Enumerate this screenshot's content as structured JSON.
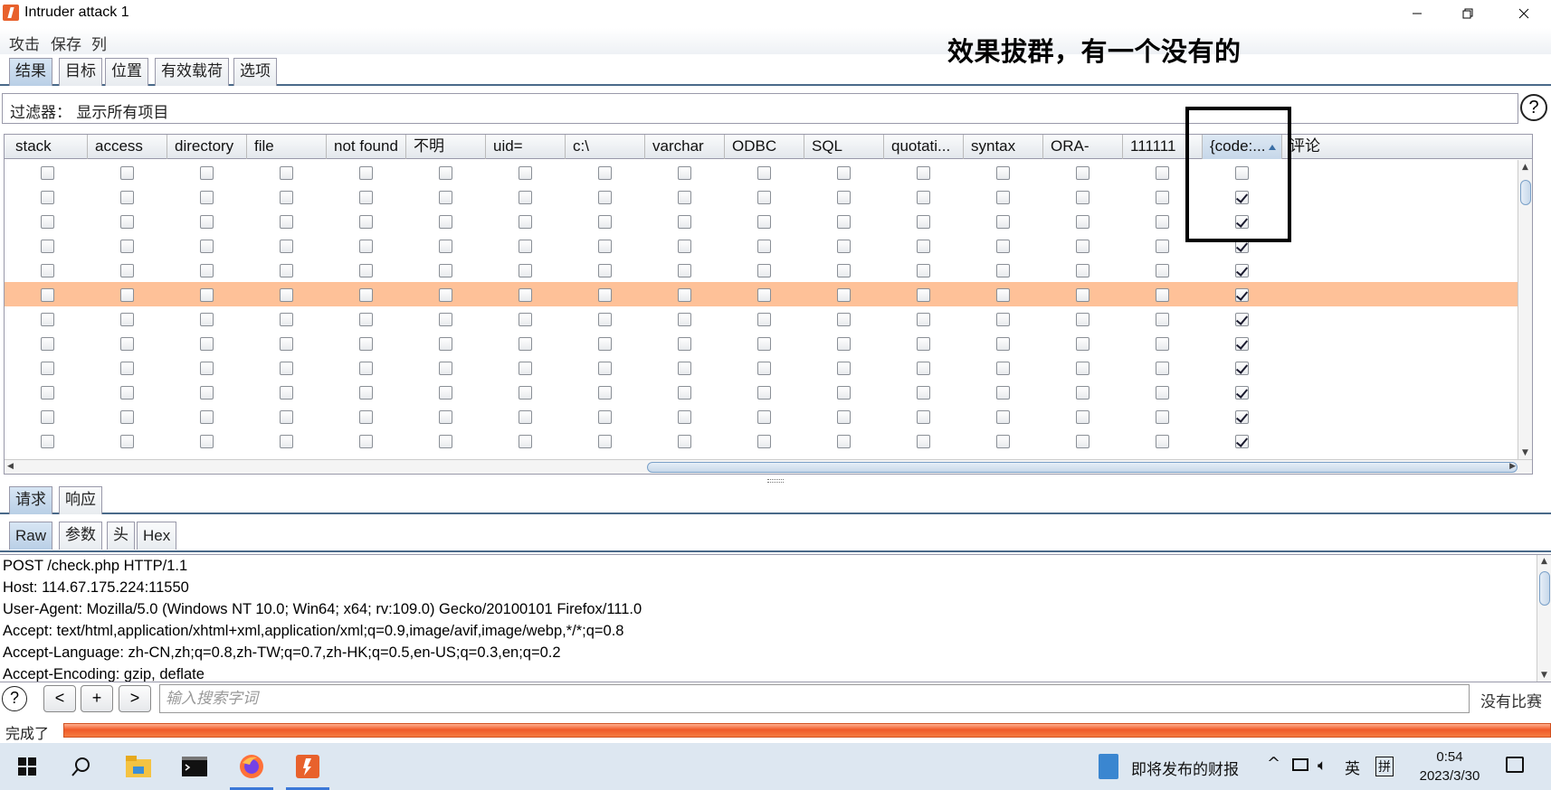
{
  "window": {
    "title": "Intruder attack 1"
  },
  "menu": [
    "攻击",
    "保存",
    "列"
  ],
  "annotation_text": "效果拔群，有一个没有的",
  "results_tabs": [
    "结果",
    "目标",
    "位置",
    "有效载荷",
    "选项"
  ],
  "filter": {
    "label": "过滤器：",
    "value": "显示所有项目"
  },
  "help_symbol": "?",
  "table": {
    "columns": [
      "stack",
      "access",
      "directory",
      "file",
      "not found",
      "不明",
      "uid=",
      "c:\\",
      "varchar",
      "ODBC",
      "SQL",
      "quotati...",
      "syntax",
      "ORA-",
      "111111",
      "{code:...",
      "评论"
    ],
    "sorted_column": "{code:...",
    "rows": [
      {
        "code_checked": false,
        "highlight": false
      },
      {
        "code_checked": true,
        "highlight": false
      },
      {
        "code_checked": true,
        "highlight": false
      },
      {
        "code_checked": true,
        "highlight": false
      },
      {
        "code_checked": true,
        "highlight": false
      },
      {
        "code_checked": true,
        "highlight": true
      },
      {
        "code_checked": true,
        "highlight": false
      },
      {
        "code_checked": true,
        "highlight": false
      },
      {
        "code_checked": true,
        "highlight": false
      },
      {
        "code_checked": true,
        "highlight": false
      },
      {
        "code_checked": true,
        "highlight": false
      },
      {
        "code_checked": true,
        "highlight": false
      },
      {
        "code_checked": true,
        "highlight": false
      }
    ],
    "highlight_color": "#fec198"
  },
  "req_tabs": [
    "请求",
    "响应"
  ],
  "view_tabs": [
    "Raw",
    "参数",
    "头",
    "Hex"
  ],
  "request_lines": [
    "POST /check.php HTTP/1.1",
    "Host: 114.67.175.224:11550",
    "User-Agent: Mozilla/5.0 (Windows NT 10.0; Win64; x64; rv:109.0) Gecko/20100101 Firefox/111.0",
    "Accept: text/html,application/xhtml+xml,application/xml;q=0.9,image/avif,image/webp,*/*;q=0.8",
    "Accept-Language: zh-CN,zh;q=0.8,zh-TW;q=0.7,zh-HK;q=0.5,en-US;q=0.3,en;q=0.2",
    "Accept-Encoding: gzip, deflate"
  ],
  "search": {
    "prev": "<",
    "add": "+",
    "next": ">",
    "placeholder": "输入搜索字词",
    "result": "没有比赛"
  },
  "status": {
    "label": "完成了",
    "progress": 1.0,
    "color": "#f05a28"
  },
  "taskbar": {
    "icons": [
      "windows-start-icon",
      "search-icon",
      "file-explorer-icon",
      "terminal-icon",
      "firefox-icon",
      "burp-suite-icon"
    ],
    "news": "即将发布的财报",
    "ime_lang": "英",
    "ime_mode": "拼",
    "time": "0:54",
    "date": "2023/3/30"
  }
}
